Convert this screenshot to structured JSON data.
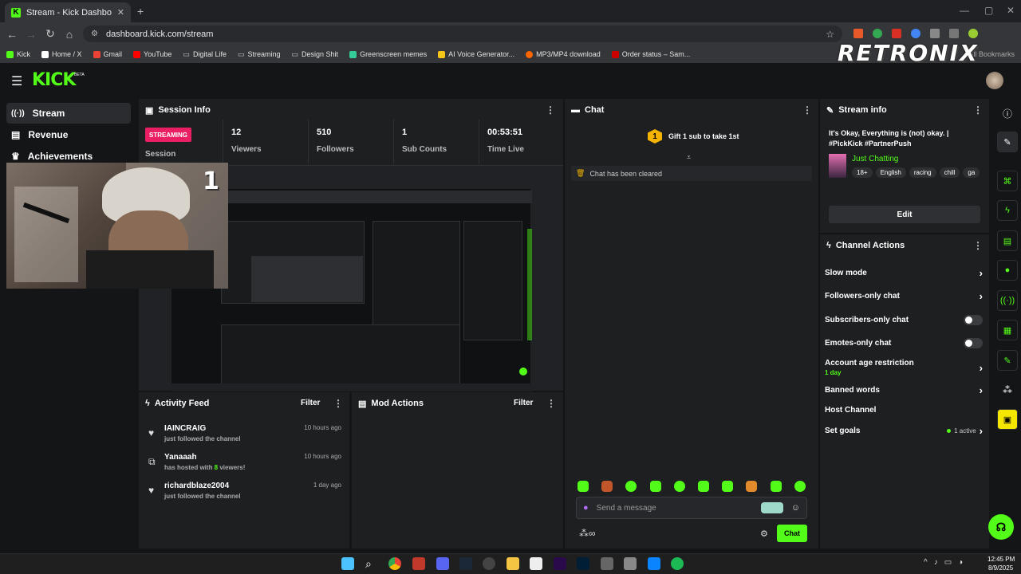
{
  "browser": {
    "tab_title": "Stream - Kick Dashboard",
    "url": "dashboard.kick.com/stream",
    "bookmarks": [
      "Kick",
      "Home / X",
      "Gmail",
      "YouTube",
      "Digital Life",
      "Streaming",
      "Design Shit",
      "Greenscreen memes",
      "AI Voice Generator...",
      "MP3/MP4 download",
      "Order status – Sam..."
    ],
    "bookmarks_right": "All Bookmarks"
  },
  "overlay": {
    "retronix_logo": "RETRONIX",
    "webcam_number": "1"
  },
  "app": {
    "logo": "KICK",
    "beta": "BETA"
  },
  "leftnav": {
    "items": [
      "Stream",
      "Revenue",
      "Achievements"
    ]
  },
  "session": {
    "title": "Session Info",
    "badge": "STREAMING",
    "badge_label": "Session",
    "stats": [
      {
        "value": "12",
        "label": "Viewers"
      },
      {
        "value": "510",
        "label": "Followers"
      },
      {
        "value": "1",
        "label": "Sub Counts"
      },
      {
        "value": "00:53:51",
        "label": "Time Live"
      }
    ]
  },
  "activity": {
    "title": "Activity Feed",
    "filter": "Filter",
    "items": [
      {
        "name": "IAINCRAIG",
        "sub": "just followed the channel",
        "time": "10 hours ago"
      },
      {
        "name": "Yanaaah",
        "sub_pre": "has hosted with ",
        "sub_num": "8",
        "sub_post": " viewers!",
        "time": "10 hours ago"
      },
      {
        "name": "richardblaze2004",
        "sub": "just followed the channel",
        "time": "1 day ago"
      }
    ]
  },
  "mod": {
    "title": "Mod Actions",
    "filter": "Filter"
  },
  "chat": {
    "title": "Chat",
    "gift_num": "1",
    "gift_text": "Gift 1 sub to take 1st",
    "cleared": "Chat has been cleared",
    "placeholder": "Send a message",
    "send": "Chat"
  },
  "streaminfo": {
    "title": "Stream info",
    "stream_title": "It's Okay, Everything is (not) okay. | #PickKick #PartnerPush",
    "category": "Just Chatting",
    "tags": [
      "18+",
      "English",
      "racing",
      "chill",
      "ga"
    ],
    "edit": "Edit"
  },
  "actions": {
    "title": "Channel Actions",
    "slow": "Slow mode",
    "followers": "Followers-only chat",
    "subscribers": "Subscribers-only chat",
    "emotes": "Emotes-only chat",
    "age": "Account age restriction",
    "age_value": "1 day",
    "banned": "Banned words",
    "host": "Host Channel",
    "goals": "Set goals",
    "goals_active": "1 active"
  },
  "taskbar": {
    "time": "12:45 PM",
    "date": "8/9/2025"
  },
  "colors": {
    "accent": "#53fc18",
    "badge": "#e91e63"
  }
}
